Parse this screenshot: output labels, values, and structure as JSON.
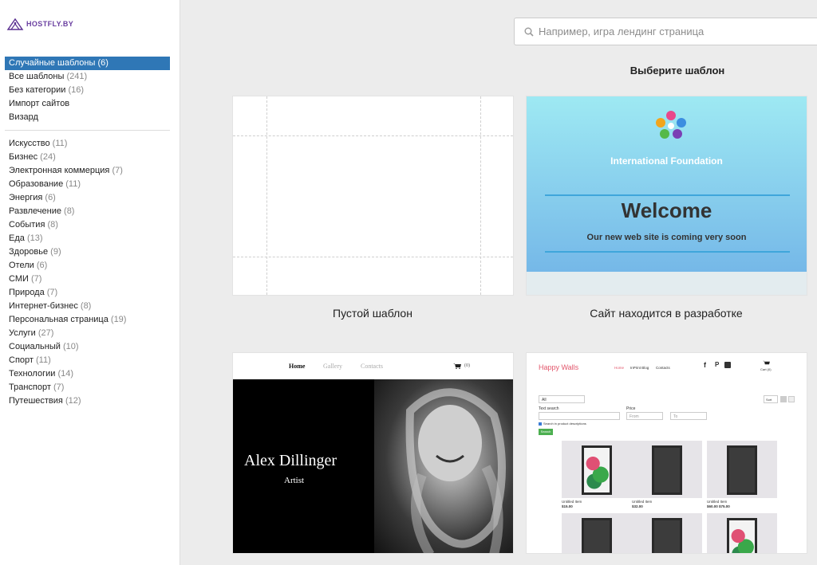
{
  "logo": {
    "text": "HOSTFLY.BY"
  },
  "sidebar": {
    "primary": [
      {
        "label": "Случайные шаблоны",
        "count": "(6)",
        "active": true
      },
      {
        "label": "Все шаблоны",
        "count": "(241)"
      },
      {
        "label": "Без категории",
        "count": "(16)"
      },
      {
        "label": "Импорт сайтов",
        "count": ""
      },
      {
        "label": "Визард",
        "count": ""
      }
    ],
    "categories": [
      {
        "label": "Искусство",
        "count": "(11)"
      },
      {
        "label": "Бизнес",
        "count": "(24)"
      },
      {
        "label": "Электронная коммерция",
        "count": "(7)"
      },
      {
        "label": "Образование",
        "count": "(11)"
      },
      {
        "label": "Энергия",
        "count": "(6)"
      },
      {
        "label": "Развлечение",
        "count": "(8)"
      },
      {
        "label": "События",
        "count": "(8)"
      },
      {
        "label": "Еда",
        "count": "(13)"
      },
      {
        "label": "Здоровье",
        "count": "(9)"
      },
      {
        "label": "Отели",
        "count": "(6)"
      },
      {
        "label": "СМИ",
        "count": "(7)"
      },
      {
        "label": "Природа",
        "count": "(7)"
      },
      {
        "label": "Интернет-бизнес",
        "count": "(8)"
      },
      {
        "label": "Персональная страница",
        "count": "(19)"
      },
      {
        "label": "Услуги",
        "count": "(27)"
      },
      {
        "label": "Социальный",
        "count": "(10)"
      },
      {
        "label": "Спорт",
        "count": "(11)"
      },
      {
        "label": "Технологии",
        "count": "(14)"
      },
      {
        "label": "Транспорт",
        "count": "(7)"
      },
      {
        "label": "Путешествия",
        "count": "(12)"
      }
    ]
  },
  "search": {
    "placeholder": "Например, игра лендинг страница"
  },
  "heading": "Выберите шаблон",
  "templates": {
    "blank": {
      "caption": "Пустой шаблон"
    },
    "construction": {
      "caption": "Сайт находится в разработке",
      "org": "International Foundation",
      "title": "Welcome",
      "subtitle": "Our new web site is coming very soon"
    },
    "artist": {
      "nav": [
        "Home",
        "Gallery",
        "Contacts"
      ],
      "cart_count": "(0)",
      "name": "Alex Dillinger",
      "role": "Artist"
    },
    "shop": {
      "brand": "Happy Walls",
      "nav": [
        "Home",
        "InPrint Blog",
        "Contacts"
      ],
      "cart": "Cart (0)",
      "filter_all": "All",
      "text_search": "Text search",
      "price": "Price",
      "from": "From",
      "to": "To",
      "search_desc": "Search in product descriptions",
      "search_btn": "Search",
      "sort": "Sort",
      "products": [
        {
          "name": "Untitled Item",
          "price": "$15.00"
        },
        {
          "name": "Untitled Item",
          "price": "$32.00"
        },
        {
          "name": "Untitled Item",
          "price": "$60.00 $75.00"
        }
      ]
    }
  },
  "colors": {
    "accent": "#2f77b6",
    "brand_pink": "#e2566b",
    "construction_blue": "#75b8e8"
  }
}
